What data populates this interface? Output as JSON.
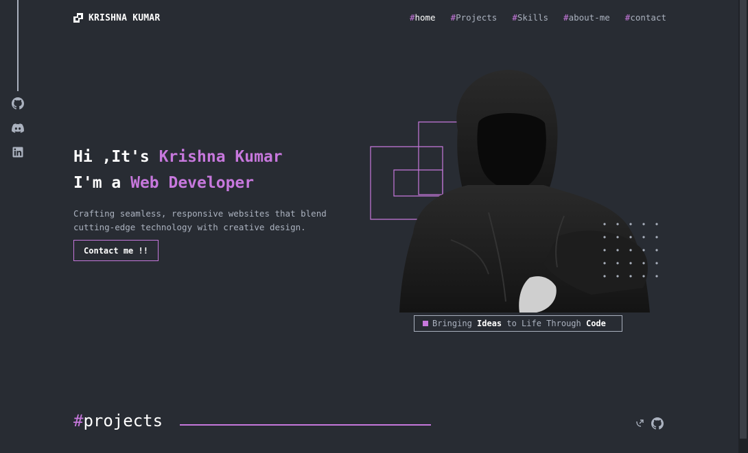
{
  "brand": {
    "name": "KRISHNA KUMAR",
    "logo_icon": "logo-mark-icon"
  },
  "nav": {
    "items": [
      {
        "hash": "#",
        "label": "home",
        "active": true
      },
      {
        "hash": "#",
        "label": "Projects",
        "active": false
      },
      {
        "hash": "#",
        "label": "Skills",
        "active": false
      },
      {
        "hash": "#",
        "label": "about-me",
        "active": false
      },
      {
        "hash": "#",
        "label": "contact",
        "active": false
      }
    ]
  },
  "sidebar": {
    "icons": [
      "github-icon",
      "discord-icon",
      "linkedin-icon"
    ]
  },
  "hero": {
    "line1_prefix": "Hi ,It's ",
    "line1_name": "Krishna Kumar",
    "line2_prefix": "I'm a ",
    "line2_role": "Web Developer",
    "description": "Crafting seamless, responsive websites that blend cutting-edge technology with creative design.",
    "cta_label": "Contact me !!"
  },
  "caption": {
    "part1": "Bringing ",
    "part2": "Ideas",
    "part3": " to Life Through ",
    "part4": "Code"
  },
  "projects": {
    "hash": "#",
    "title": "projects",
    "icons": [
      "external-link-icon",
      "github-icon"
    ]
  },
  "colors": {
    "background": "#282c33",
    "accent": "#c778dd",
    "text_muted": "#abb2bf",
    "text": "#ffffff"
  }
}
